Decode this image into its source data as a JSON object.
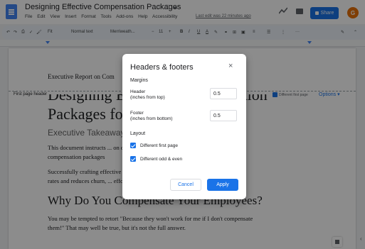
{
  "app": {
    "doc_title": "Designing Effective Compensation Packages",
    "menu": [
      "File",
      "Edit",
      "View",
      "Insert",
      "Format",
      "Tools",
      "Add-ons",
      "Help",
      "Accessibility"
    ],
    "last_edit": "Last edit was 22 minutes ago",
    "share_label": "Share",
    "avatar_initial": "G",
    "accent_color": "#1a73e8"
  },
  "toolbar": {
    "zoom": "Fit",
    "style": "Normal text",
    "font": "Merriweath...",
    "font_size": "11",
    "bold": "B",
    "italic": "I",
    "underline": "U",
    "text_color": "A",
    "more": "···"
  },
  "document": {
    "header_text": "Executive Report on Com",
    "first_page_header_label": "First page header",
    "different_first_page_label": "Different first page",
    "options_label": "Options",
    "heading_line1": "Designing Effective Compensation",
    "heading_line2": "Packages for Employees",
    "subtitle": "Executive Takeaway",
    "para1_line1": "This document instructs ... on designing custom",
    "para1_line2": "compensation packages",
    "para2_line1": "Successfully crafting effective ... increases retention",
    "para2_line2": "rates and reduces churn, ... effort.",
    "h2": "Why Do You Compensate Your Employees?",
    "para3_line1": "You may be tempted to retort \"Because they won't work for me if I don't compensate",
    "para3_line2": "them!\" That may well be true, but it's not the full answer."
  },
  "dialog": {
    "title": "Headers & footers",
    "close_glyph": "×",
    "margins_label": "Margins",
    "header_label_1": "Header",
    "header_label_2": "(inches from top)",
    "header_value": "0.5",
    "footer_label_1": "Footer",
    "footer_label_2": "(inches from bottom)",
    "footer_value": "0.5",
    "layout_label": "Layout",
    "different_first_page": "Different first page",
    "different_first_page_checked": true,
    "different_odd_even": "Different odd & even",
    "different_odd_even_checked": true,
    "cancel_label": "Cancel",
    "apply_label": "Apply"
  }
}
